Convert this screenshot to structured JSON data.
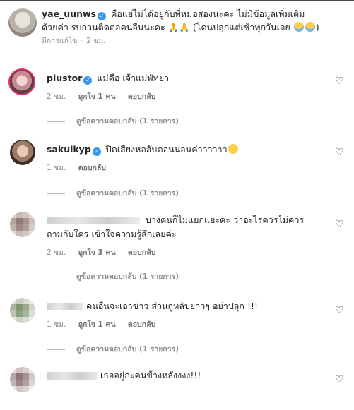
{
  "caption": {
    "username": "yae_uunws",
    "text_line1": "คือแย่ไม่ได้อยู่กับพี่หมอสองนะคะ ไม่มีข้อมูลเพิ่มเติม",
    "text_line2": "ด้วยค่า รบกวนติดต่อคนอื่นนะคะ",
    "text_line2_tail": " (โดนปลุกแต่เช้าทุกวันเลย",
    "edited": "มีการแก้ไข",
    "time": "2 ชม."
  },
  "comments": [
    {
      "username": "plustor",
      "verified": true,
      "text": "แม่คือ เจ้าแม่พัทยา",
      "time": "2 ชม.",
      "likes": "ถูกใจ 1 คน",
      "reply": "ตอบกลับ",
      "view_replies": "ดูข้อความตอบกลับ (1 รายการ)"
    },
    {
      "username": "sakulkyp",
      "verified": true,
      "text": "ปิดเสียงหอสับตอนนอนค่าาาาาา",
      "time": "1 ชม.",
      "likes": "",
      "reply": "ตอบกลับ",
      "view_replies": "ดูข้อความตอบกลับ (1 รายการ)"
    },
    {
      "username": "",
      "verified": false,
      "text_line1": "บางคนก็ไม่แยกแยะคะ ว่าอะไรควรไม่ควร",
      "text_line2": "ถามกับใคร เข้าใจความรู้สึกเลยค่ะ",
      "time": "2 ชม.",
      "likes": "ถูกใจ 3 คน",
      "reply": "ตอบกลับ",
      "view_replies": "ดูข้อความตอบกลับ (1 รายการ)"
    },
    {
      "username": "",
      "verified": false,
      "text": "คนอื่นจะเอาข่าว ส่วนกูหลับยาวๆ อย่าปลุก !!!",
      "time": "1 ชม.",
      "likes": "ถูกใจ 1 คน",
      "reply": "ตอบกลับ",
      "view_replies": "ดูข้อความตอบกลับ (1 รายการ)"
    },
    {
      "username": "",
      "verified": false,
      "text": "เธออยู่กะคนข้างหลังงงง!!!",
      "time": "",
      "likes": "",
      "reply": "",
      "view_replies": ""
    }
  ],
  "colors": {
    "verified": "#3897f0",
    "muted": "#8e8e8e",
    "text": "#262626"
  },
  "icons": {
    "verified": "verified-badge-icon",
    "like": "heart-outline-icon"
  }
}
